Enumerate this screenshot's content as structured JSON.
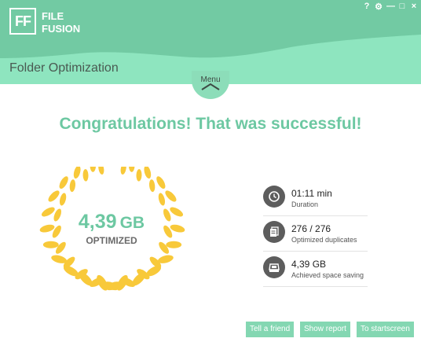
{
  "app": {
    "logo_text": "FF",
    "brand_line1": "FILE",
    "brand_line2": "FUSION"
  },
  "window_controls": {
    "help": "?",
    "settings": "⚙",
    "minimize": "—",
    "maximize": "□",
    "close": "×"
  },
  "section_title": "Folder Optimization",
  "menu": {
    "label": "Menu"
  },
  "headline": "Congratulations! That was successful!",
  "result": {
    "value": "4,39",
    "unit": "GB",
    "caption": "OPTIMIZED"
  },
  "stats": [
    {
      "icon": "clock-icon",
      "value": "01:11 min",
      "label": "Duration"
    },
    {
      "icon": "documents-icon",
      "value": "276 / 276",
      "label": "Optimized duplicates"
    },
    {
      "icon": "disk-icon",
      "value": "4,39 GB",
      "label": "Achieved space saving"
    }
  ],
  "buttons": {
    "tell_friend": "Tell a friend",
    "show_report": "Show report",
    "to_startscreen": "To startscreen"
  },
  "colors": {
    "accent": "#6dc8a2",
    "header_light": "#8ee5bf",
    "header_dark": "#72caa3",
    "wreath": "#f8c93a",
    "icon_bg": "#5d5d5d"
  }
}
